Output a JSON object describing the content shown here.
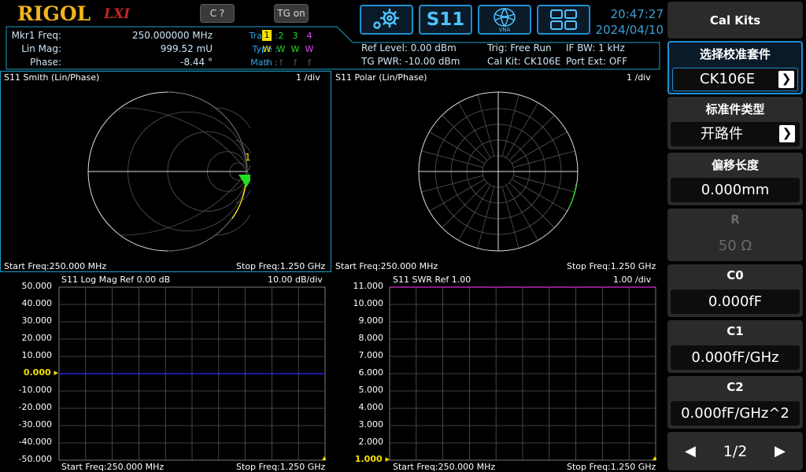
{
  "header": {
    "brand": "RIGOL",
    "lxi": "LXI",
    "c_button": "C ?",
    "tg_button": "TG on",
    "s11_button": "S11",
    "vna_label": "VNA",
    "time": "20:47:27",
    "date": "2024/04/10"
  },
  "marker": {
    "freq_label": "Mkr1 Freq:",
    "freq_value": "250.000000 MHz",
    "mag_label": "Lin Mag:",
    "mag_value": "999.52 mU",
    "phase_label": "Phase:",
    "phase_value": "-8.44 °"
  },
  "trace": {
    "trace_label": "Trace :",
    "trace_items": [
      "1",
      "2",
      "3",
      "4"
    ],
    "type_label": "Type :",
    "type_items": [
      "W",
      "W",
      "W",
      "W"
    ],
    "math_label": "Math :",
    "math_items": [
      "f",
      "f",
      "f",
      "f"
    ]
  },
  "status": {
    "ref_level": "Ref Level: 0.00 dBm",
    "tg_pwr": "TG PWR: -10.00 dBm",
    "trig": "Trig: Free Run",
    "cal_kit": "Cal Kit: CK106E",
    "if_bw": "IF BW: 1 kHz",
    "port_ext": "Port Ext: OFF"
  },
  "panels": {
    "smith": {
      "title": "S11  Smith (Lin/Phase)",
      "div": "1  /div",
      "start": "Start Freq:250.000 MHz",
      "stop": "Stop Freq:1.250 GHz",
      "marker": "1"
    },
    "polar": {
      "title": "S11  Polar (Lin/Phase)",
      "div": "1  /div",
      "start": "Start Freq:250.000 MHz",
      "stop": "Stop Freq:1.250 GHz"
    },
    "logmag": {
      "title": "S11  Log Mag   Ref 0.00 dB",
      "div": "10.00  dB/div",
      "start": "Start Freq:250.000 MHz",
      "stop": "Stop Freq:1.250 GHz",
      "yticks": [
        "50.000",
        "40.000",
        "30.000",
        "20.000",
        "10.000",
        "0.000",
        "-10.000",
        "-20.000",
        "-30.000",
        "-40.000",
        "-50.000"
      ]
    },
    "swr": {
      "title": "S11  SWR    Ref 1.00",
      "div": "1.00  /div",
      "start": "Start Freq:250.000 MHz",
      "stop": "Stop Freq:1.250 GHz",
      "yticks": [
        "11.000",
        "10.000",
        "9.000",
        "8.000",
        "7.000",
        "6.000",
        "5.000",
        "4.000",
        "3.000",
        "2.000",
        "1.000"
      ]
    }
  },
  "menu": {
    "title": "Cal Kits",
    "items": [
      {
        "label": "选择校准套件",
        "value": "CK106E"
      },
      {
        "label": "标准件类型",
        "value": "开路件"
      },
      {
        "label": "偏移长度",
        "value": "0.000mm"
      },
      {
        "label": "R",
        "value": "50 Ω"
      },
      {
        "label": "C0",
        "value": "0.000fF"
      },
      {
        "label": "C1",
        "value": "0.000fF/GHz"
      },
      {
        "label": "C2",
        "value": "0.000fF/GHz^2"
      }
    ],
    "page": "1/2"
  },
  "colors": {
    "accent": "#1f8fcf",
    "trace_yellow": "#f5e000",
    "marker_green": "#22dd22",
    "log_trace": "#2a2aff",
    "swr_trace": "#ff40ff"
  }
}
